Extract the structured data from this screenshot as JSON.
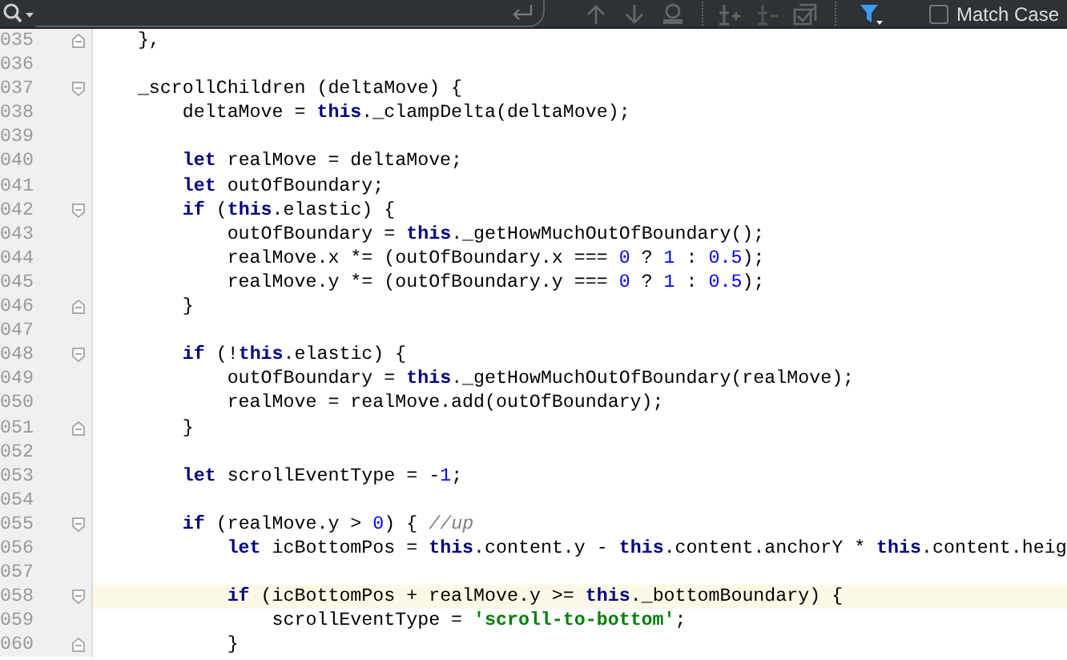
{
  "find_bar": {
    "match_case": {
      "label": "Match Case",
      "checked": false
    }
  },
  "editor": {
    "lines": [
      {
        "number": "035",
        "fold_open": false,
        "fold_close": true,
        "current": false,
        "tokens": [
          {
            "kind": "plain",
            "text": "    },"
          }
        ]
      },
      {
        "number": "036",
        "fold_open": false,
        "fold_close": false,
        "current": false
      },
      {
        "number": "037",
        "fold_open": true,
        "fold_close": false,
        "current": false,
        "tokens": [
          {
            "kind": "plain",
            "text": "    _scrollChildren (deltaMove) {"
          }
        ]
      },
      {
        "number": "038",
        "fold_open": false,
        "fold_close": false,
        "current": false,
        "tokens": [
          {
            "kind": "plain",
            "text": "        deltaMove = "
          },
          {
            "kind": "keyword",
            "text": "this"
          },
          {
            "kind": "plain",
            "text": "._clampDelta(deltaMove);"
          }
        ]
      },
      {
        "number": "039",
        "fold_open": false,
        "fold_close": false,
        "current": false
      },
      {
        "number": "040",
        "fold_open": false,
        "fold_close": false,
        "current": false,
        "tokens": [
          {
            "kind": "keyword",
            "text": "        let"
          },
          {
            "kind": "plain",
            "text": " realMove = deltaMove;"
          }
        ]
      },
      {
        "number": "041",
        "fold_open": false,
        "fold_close": false,
        "current": false,
        "tokens": [
          {
            "kind": "keyword",
            "text": "        let"
          },
          {
            "kind": "plain",
            "text": " outOfBoundary;"
          }
        ]
      },
      {
        "number": "042",
        "fold_open": true,
        "fold_close": false,
        "current": false,
        "tokens": [
          {
            "kind": "keyword",
            "text": "        if"
          },
          {
            "kind": "plain",
            "text": " ("
          },
          {
            "kind": "keyword",
            "text": "this"
          },
          {
            "kind": "plain",
            "text": ".elastic) {"
          }
        ]
      },
      {
        "number": "043",
        "fold_open": false,
        "fold_close": false,
        "current": false,
        "tokens": [
          {
            "kind": "plain",
            "text": "            outOfBoundary = "
          },
          {
            "kind": "keyword",
            "text": "this"
          },
          {
            "kind": "plain",
            "text": "._getHowMuchOutOfBoundary();"
          }
        ]
      },
      {
        "number": "044",
        "fold_open": false,
        "fold_close": false,
        "current": false,
        "tokens": [
          {
            "kind": "plain",
            "text": "            realMove.x *= (outOfBoundary.x === "
          },
          {
            "kind": "number",
            "text": "0"
          },
          {
            "kind": "plain",
            "text": " ? "
          },
          {
            "kind": "number",
            "text": "1"
          },
          {
            "kind": "plain",
            "text": " : "
          },
          {
            "kind": "number",
            "text": "0.5"
          },
          {
            "kind": "plain",
            "text": ");"
          }
        ]
      },
      {
        "number": "045",
        "fold_open": false,
        "fold_close": false,
        "current": false,
        "tokens": [
          {
            "kind": "plain",
            "text": "            realMove.y *= (outOfBoundary.y === "
          },
          {
            "kind": "number",
            "text": "0"
          },
          {
            "kind": "plain",
            "text": " ? "
          },
          {
            "kind": "number",
            "text": "1"
          },
          {
            "kind": "plain",
            "text": " : "
          },
          {
            "kind": "number",
            "text": "0.5"
          },
          {
            "kind": "plain",
            "text": ");"
          }
        ]
      },
      {
        "number": "046",
        "fold_open": false,
        "fold_close": true,
        "current": false,
        "tokens": [
          {
            "kind": "plain",
            "text": "        }"
          }
        ]
      },
      {
        "number": "047",
        "fold_open": false,
        "fold_close": false,
        "current": false
      },
      {
        "number": "048",
        "fold_open": true,
        "fold_close": false,
        "current": false,
        "tokens": [
          {
            "kind": "keyword",
            "text": "        if"
          },
          {
            "kind": "plain",
            "text": " (!"
          },
          {
            "kind": "keyword",
            "text": "this"
          },
          {
            "kind": "plain",
            "text": ".elastic) {"
          }
        ]
      },
      {
        "number": "049",
        "fold_open": false,
        "fold_close": false,
        "current": false,
        "tokens": [
          {
            "kind": "plain",
            "text": "            outOfBoundary = "
          },
          {
            "kind": "keyword",
            "text": "this"
          },
          {
            "kind": "plain",
            "text": "._getHowMuchOutOfBoundary(realMove);"
          }
        ]
      },
      {
        "number": "050",
        "fold_open": false,
        "fold_close": false,
        "current": false,
        "tokens": [
          {
            "kind": "plain",
            "text": "            realMove = realMove.add(outOfBoundary);"
          }
        ]
      },
      {
        "number": "051",
        "fold_open": false,
        "fold_close": true,
        "current": false,
        "tokens": [
          {
            "kind": "plain",
            "text": "        }"
          }
        ]
      },
      {
        "number": "052",
        "fold_open": false,
        "fold_close": false,
        "current": false
      },
      {
        "number": "053",
        "fold_open": false,
        "fold_close": false,
        "current": false,
        "tokens": [
          {
            "kind": "keyword",
            "text": "        let"
          },
          {
            "kind": "plain",
            "text": " scrollEventType = -"
          },
          {
            "kind": "number",
            "text": "1"
          },
          {
            "kind": "plain",
            "text": ";"
          }
        ]
      },
      {
        "number": "054",
        "fold_open": false,
        "fold_close": false,
        "current": false
      },
      {
        "number": "055",
        "fold_open": true,
        "fold_close": false,
        "current": false,
        "tokens": [
          {
            "kind": "keyword",
            "text": "        if"
          },
          {
            "kind": "plain",
            "text": " (realMove.y > "
          },
          {
            "kind": "number",
            "text": "0"
          },
          {
            "kind": "plain",
            "text": ") { "
          },
          {
            "kind": "comment",
            "text": "//up"
          }
        ]
      },
      {
        "number": "056",
        "fold_open": false,
        "fold_close": false,
        "current": false,
        "tokens": [
          {
            "kind": "keyword",
            "text": "            let"
          },
          {
            "kind": "plain",
            "text": " icBottomPos = "
          },
          {
            "kind": "keyword",
            "text": "this"
          },
          {
            "kind": "plain",
            "text": ".content.y - "
          },
          {
            "kind": "keyword",
            "text": "this"
          },
          {
            "kind": "plain",
            "text": ".content.anchorY * "
          },
          {
            "kind": "keyword",
            "text": "this"
          },
          {
            "kind": "plain",
            "text": ".content.heig"
          }
        ]
      },
      {
        "number": "057",
        "fold_open": false,
        "fold_close": false,
        "current": false
      },
      {
        "number": "058",
        "fold_open": true,
        "fold_close": false,
        "current": true,
        "tokens": [
          {
            "kind": "keyword",
            "text": "            if"
          },
          {
            "kind": "plain",
            "text": " (icBottomPos + realMove.y >= "
          },
          {
            "kind": "keyword",
            "text": "this"
          },
          {
            "kind": "plain",
            "text": "._bottomBoundary) {"
          }
        ]
      },
      {
        "number": "059",
        "fold_open": false,
        "fold_close": false,
        "current": false,
        "tokens": [
          {
            "kind": "plain",
            "text": "                scrollEventType = "
          },
          {
            "kind": "string",
            "text": "'scroll-to-bottom'"
          },
          {
            "kind": "plain",
            "text": ";"
          }
        ]
      },
      {
        "number": "060",
        "fold_open": false,
        "fold_close": true,
        "current": false,
        "tokens": [
          {
            "kind": "plain",
            "text": "            }"
          }
        ]
      }
    ]
  }
}
